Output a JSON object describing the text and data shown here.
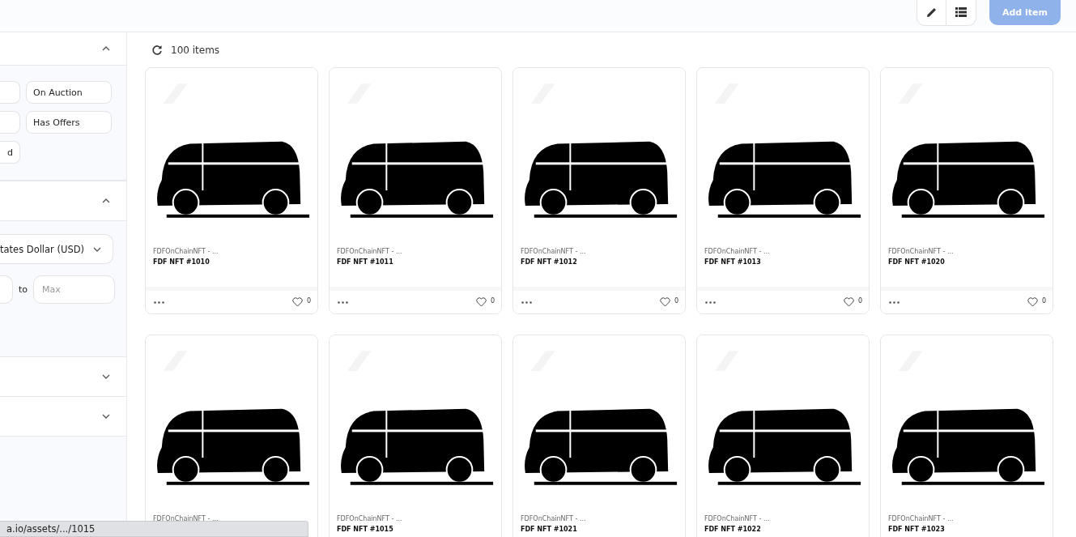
{
  "header": {
    "buttons": [
      {
        "kind": "edit"
      },
      {
        "kind": "list"
      }
    ],
    "add_button": {
      "label": "Add item",
      "disabled": true
    }
  },
  "sidebar": {
    "sections": [
      {
        "expanded": true,
        "kind": "status",
        "buttons": [
          {
            "cut": true
          },
          {
            "cut": false,
            "label": "On Auction"
          },
          {
            "cut": true
          },
          {
            "cut": false,
            "label": "Has Offers"
          },
          {
            "cut": true,
            "label": "d"
          }
        ]
      },
      {
        "expanded": true,
        "kind": "price",
        "currency": "tates Dollar (USD)",
        "separator": "to",
        "max_placeholder": "Max"
      },
      {
        "expanded": false
      },
      {
        "expanded": false
      }
    ]
  },
  "toolbar": {
    "count": "100 items"
  },
  "cards": [
    {
      "collection": "FDFOnChainNFT - ...",
      "name": "FDF NFT #1010",
      "likes": "0"
    },
    {
      "collection": "FDFOnChainNFT - ...",
      "name": "FDF NFT #1011",
      "likes": "0"
    },
    {
      "collection": "FDFOnChainNFT - ...",
      "name": "FDF NFT #1012",
      "likes": "0"
    },
    {
      "collection": "FDFOnChainNFT - ...",
      "name": "FDF NFT #1013",
      "likes": "0"
    },
    {
      "collection": "FDFOnChainNFT - ...",
      "name": "FDF NFT #1020",
      "likes": "0"
    },
    {
      "collection": "FDFOnChainNFT - ..."
    },
    {
      "collection": "FDFOnChainNFT - ...",
      "name": "FDF NFT #1015"
    },
    {
      "collection": "FDFOnChainNFT - ...",
      "name": "FDF NFT #1021"
    },
    {
      "collection": "FDFOnChainNFT - ...",
      "name": "FDF NFT #1022"
    },
    {
      "collection": "FDFOnChainNFT - ...",
      "name": "FDF NFT #1023"
    }
  ],
  "status_bar": {
    "url": "a.io/assets/.../1015"
  }
}
